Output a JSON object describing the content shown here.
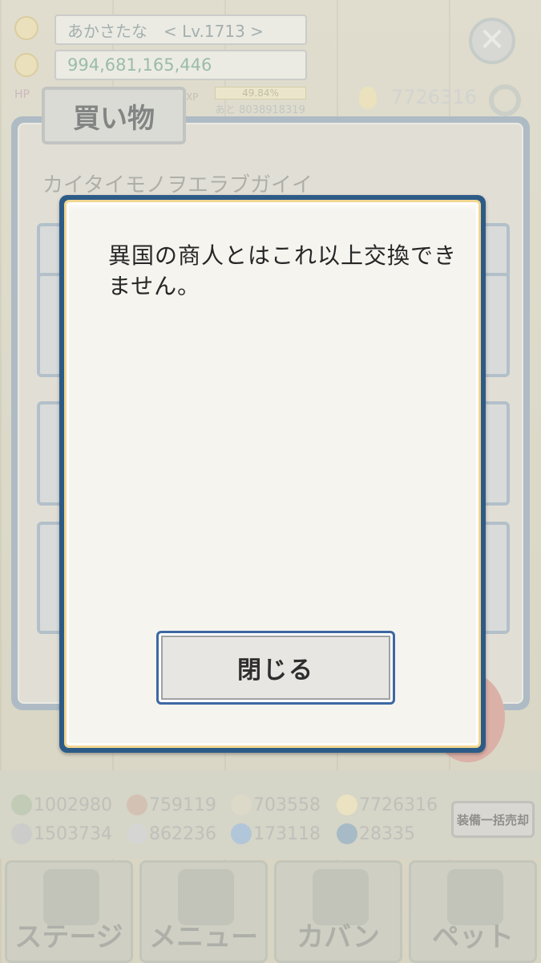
{
  "hud": {
    "player_name": "あかさたな　< Lv.1713 >",
    "gold": "994,681,165,446",
    "xp_percent": "49.84%",
    "xp_next": "あと 8038918319",
    "crystals": "7726316",
    "hp_label": "HP",
    "xp_label": "XP"
  },
  "shop": {
    "title": "買い物",
    "subtitle": "カイタイモノヲエラブガイイ"
  },
  "resources": [
    {
      "icon": "herb-icon",
      "value": "1002980"
    },
    {
      "icon": "wood-icon",
      "value": "759119"
    },
    {
      "icon": "bone-icon",
      "value": "703558"
    },
    {
      "icon": "crystal-drop-icon",
      "value": "7726316"
    },
    {
      "icon": "iron-ingot-icon",
      "value": "1503734"
    },
    {
      "icon": "stone-icon",
      "value": "862236"
    },
    {
      "icon": "flame-icon",
      "value": "173118"
    },
    {
      "icon": "orb-icon",
      "value": "28335"
    }
  ],
  "sell_all_label": "装備一括売却",
  "nav": [
    {
      "label": "ステージ",
      "icon": "crossed-swords-icon"
    },
    {
      "label": "メニュー",
      "icon": "book-icon"
    },
    {
      "label": "カバン",
      "icon": "backpack-icon"
    },
    {
      "label": "ペット",
      "icon": "dragon-icon"
    }
  ],
  "dialog": {
    "message": "異国の商人とはこれ以上交換できません。",
    "close_label": "閉じる"
  },
  "colors": {
    "dialog_border": "#2d5b88",
    "button_border": "#3c68a3"
  }
}
